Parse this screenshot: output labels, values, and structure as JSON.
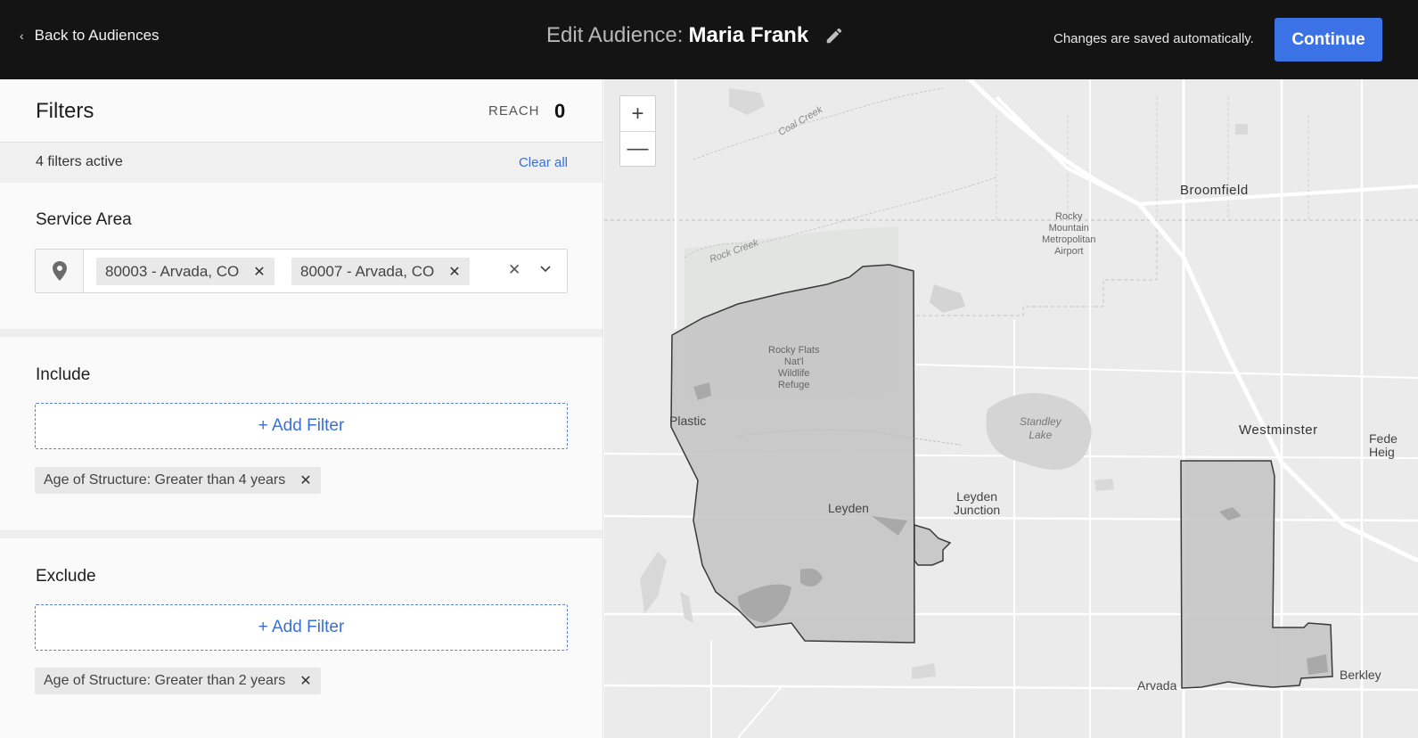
{
  "header": {
    "back_label": "Back to Audiences",
    "title_prefix": "Edit Audience:",
    "audience_name": "Maria Frank",
    "autosave_text": "Changes are saved automatically.",
    "continue_label": "Continue"
  },
  "filters": {
    "heading": "Filters",
    "reach_label": "REACH",
    "reach_value": "0",
    "active_text": "4 filters active",
    "clear_all_label": "Clear all"
  },
  "service_area": {
    "title": "Service Area",
    "chips": [
      "80003 - Arvada, CO",
      "80007 - Arvada, CO"
    ],
    "clear_symbol": "×"
  },
  "include": {
    "title": "Include",
    "add_label": "+ Add Filter",
    "tags": [
      "Age of Structure: Greater than 4 years"
    ]
  },
  "exclude": {
    "title": "Exclude",
    "add_label": "+ Add Filter",
    "tags": [
      "Age of Structure: Greater than 2 years"
    ]
  },
  "map": {
    "zoom_in": "+",
    "zoom_out": "—",
    "labels": {
      "broomfield": "Broomfield",
      "airport": "Rocky\nMountain\nMetropolitan\nAirport",
      "refuge": "Rocky Flats\nNat'l\nWildlife\nRefuge",
      "plastic": "Plastic",
      "leyden": "Leyden",
      "leyden_junction": "Leyden\nJunction",
      "standley": "Standley\nLake",
      "westminster": "Westminster",
      "federal": "Fede\nHeig",
      "arvada": "Arvada",
      "berkley": "Berkley",
      "coal_creek": "Coal Creek",
      "rock_creek": "Rock Creek"
    }
  }
}
